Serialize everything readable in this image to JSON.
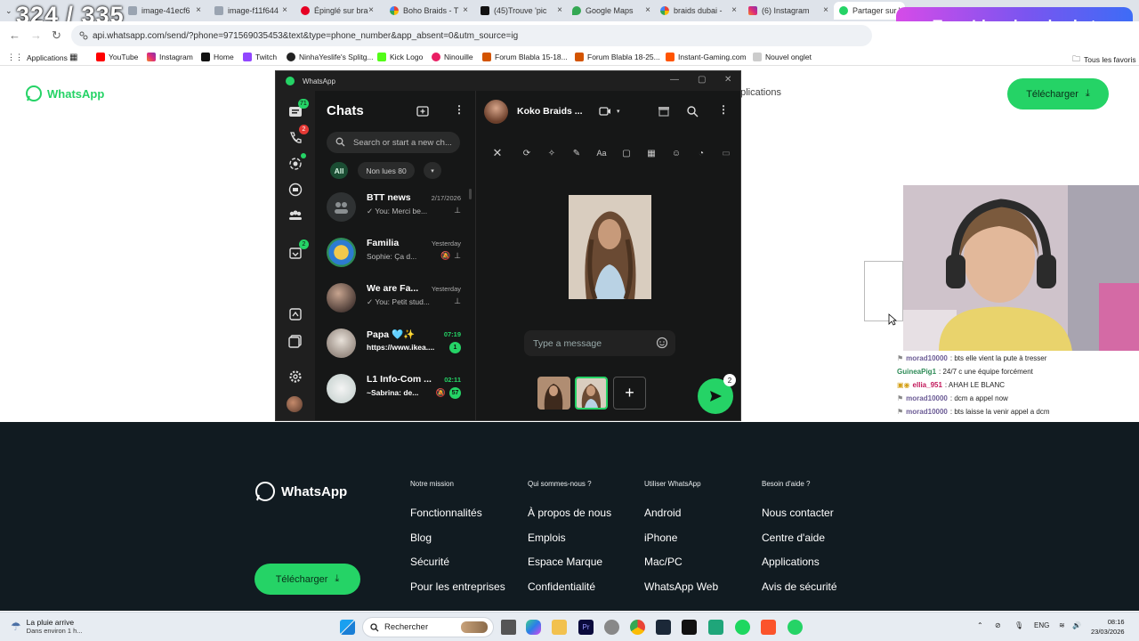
{
  "browser": {
    "tabs": [
      {
        "title": "324 / 335",
        "kind": "overlay"
      },
      {
        "title": "image-41ecf6"
      },
      {
        "title": "image-f11f644"
      },
      {
        "title": "Épinglé sur bra"
      },
      {
        "title": "Boho Braids - T"
      },
      {
        "title": "(45)Trouve 'pic"
      },
      {
        "title": "Google Maps"
      },
      {
        "title": "braids dubai -"
      },
      {
        "title": "(6) Instagram"
      },
      {
        "title": "Partager sur W"
      }
    ],
    "url": "api.whatsapp.com/send/?phone=971569035453&text&type=phone_number&app_absent=0&utm_source=ig",
    "bookmarks": [
      "Applications",
      "YouTube",
      "Instagram",
      "Home",
      "Twitch",
      "NinhaYeslife's Splitg...",
      "Kick Logo",
      "Ninouille",
      "Forum Blabla 15-18...",
      "Forum Blabla 18-25...",
      "Instant-Gaming.com",
      "Nouvel onglet"
    ],
    "all_bookmarks": "Tous les favoris"
  },
  "overlay": {
    "counter": "324 / 335",
    "donate_text": "Tape !don dans le chat"
  },
  "page": {
    "logo_text": "WhatsApp",
    "nav_partial": "pplications",
    "download_label": "Télécharger",
    "footer": {
      "logo_text": "WhatsApp",
      "download_label": "Télécharger",
      "columns": [
        {
          "heading": "Notre mission",
          "links": [
            "Fonctionnalités",
            "Blog",
            "Sécurité",
            "Pour les entreprises"
          ]
        },
        {
          "heading": "Qui sommes-nous ?",
          "links": [
            "À propos de nous",
            "Emplois",
            "Espace Marque",
            "Confidentialité"
          ]
        },
        {
          "heading": "Utiliser WhatsApp",
          "links": [
            "Android",
            "iPhone",
            "Mac/PC",
            "WhatsApp Web"
          ]
        },
        {
          "heading": "Besoin d'aide ?",
          "links": [
            "Nous contacter",
            "Centre d'aide",
            "Applications",
            "Avis de sécurité"
          ]
        }
      ]
    }
  },
  "whatsapp": {
    "window_title": "WhatsApp",
    "rail_badges": {
      "chats": "71",
      "calls": "2",
      "archive": "2"
    },
    "list_title": "Chats",
    "search_placeholder": "Search or start a new ch...",
    "filters": {
      "all": "All",
      "unread": "Non lues 80"
    },
    "chats": [
      {
        "name": "BTT news",
        "time": "2/17/2026",
        "preview": "✓ You: Merci be...",
        "pinned": true,
        "muted": false,
        "unread": ""
      },
      {
        "name": "Familia",
        "time": "Yesterday",
        "preview": "Sophie: Ça d...",
        "pinned": true,
        "muted": true,
        "unread": ""
      },
      {
        "name": "We are Fa...",
        "time": "Yesterday",
        "preview": "✓ You: Petit stud...",
        "pinned": true,
        "muted": false,
        "unread": ""
      },
      {
        "name": "Papa 🩵✨",
        "time": "07:19",
        "preview": "https://www.ikea....",
        "pinned": false,
        "muted": false,
        "unread": "1"
      },
      {
        "name": "L1 Info-Com ...",
        "time": "02:11",
        "preview": "~Sabrina: de...",
        "pinned": false,
        "muted": true,
        "unread": "57"
      }
    ],
    "conversation": {
      "contact_name": "Koko Braids ...",
      "message_placeholder": "Type a message",
      "send_count": "2"
    }
  },
  "stream_chat": [
    {
      "user": "morad10000",
      "color": "#6b5b95",
      "text": ": bts elle vient la pute à tresser"
    },
    {
      "user": "GuineaPig1",
      "color": "#2e8b57",
      "text": ": 24/7 c une équipe forcément"
    },
    {
      "user": "ellia_951",
      "color": "#c2185b",
      "text": ": AHAH LE BLANC"
    },
    {
      "user": "morad10000",
      "color": "#6b5b95",
      "text": ": dcm a appel now"
    },
    {
      "user": "morad10000",
      "color": "#6b5b95",
      "text": ": bts laisse la venir appel a dcm"
    }
  ],
  "taskbar": {
    "weather_title": "La pluie arrive",
    "weather_sub": "Dans environ 1 h...",
    "search_label": "Rechercher",
    "lang": "ENG",
    "time": "08:16",
    "date": "23/03/2026"
  },
  "colors": {
    "whatsapp_green": "#25d366",
    "footer_bg": "#111b21",
    "wa_panel": "#161717"
  }
}
